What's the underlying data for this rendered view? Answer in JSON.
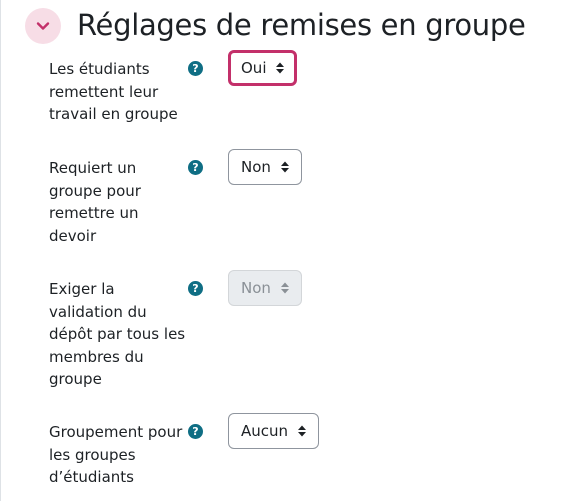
{
  "section": {
    "title": "Réglages de remises en groupe",
    "toggle_icon": "chevron-down-icon",
    "accent_color": "#c3306a",
    "toggle_bg": "#f7dde6"
  },
  "help_icon_glyph": "?",
  "fields": [
    {
      "label": "Les étudiants remettent leur travail en groupe",
      "value": "Oui",
      "state": "focused"
    },
    {
      "label": "Requiert un groupe pour remettre un devoir",
      "value": "Non",
      "state": "enabled"
    },
    {
      "label": "Exiger la validation du dépôt par tous les membres du groupe",
      "value": "Non",
      "state": "disabled"
    },
    {
      "label": "Groupement pour les groupes d’étudiants",
      "value": "Aucun",
      "state": "enabled"
    }
  ]
}
